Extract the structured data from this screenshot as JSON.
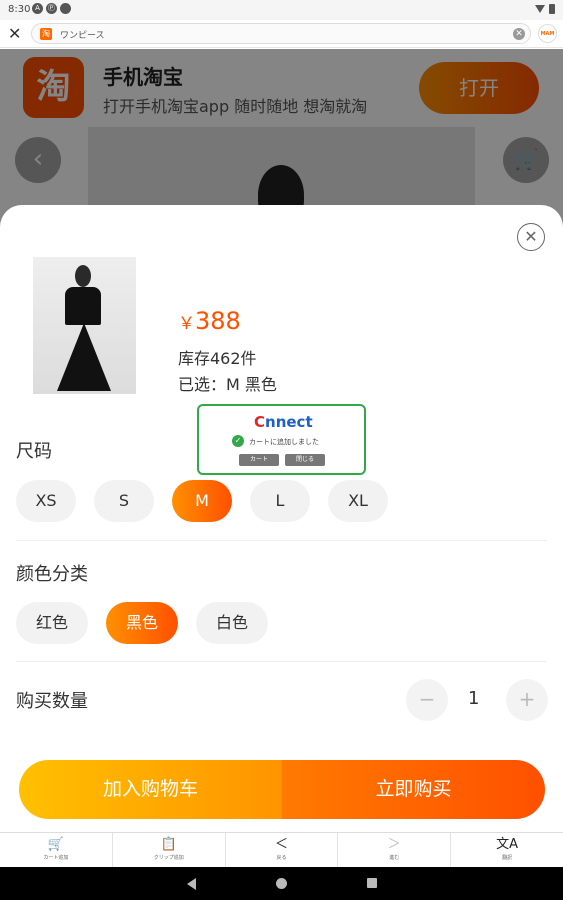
{
  "status_bar": {
    "time": "8:30",
    "icon_a": "A",
    "icon_b": "Ⓟ"
  },
  "browser": {
    "close_icon": "✕",
    "url_favicon": "淘",
    "url_text": "ワンピース",
    "clear_icon": "✕",
    "profile_label": "MAM"
  },
  "app_banner": {
    "logo_char": "淘",
    "name": "手机淘宝",
    "description": "打开手机淘宝app 随时随地 想淘就淘",
    "open_label": "打开"
  },
  "page_nav": {
    "back_icon": "‹",
    "cart_icon": "🛒"
  },
  "sheet": {
    "close_icon": "✕",
    "price_currency": "￥",
    "price_value": "388",
    "stock_text": "库存462件",
    "selected_text": "已选：M 黑色",
    "size_section": {
      "title": "尺码",
      "options": [
        "XS",
        "S",
        "M",
        "L",
        "XL"
      ],
      "selected": "M"
    },
    "color_section": {
      "title": "颜色分类",
      "options": [
        "红色",
        "黑色",
        "白色"
      ],
      "selected": "黑色"
    },
    "quantity_section": {
      "title": "购买数量",
      "minus_icon": "−",
      "value": "1",
      "plus_icon": "+"
    },
    "add_to_cart_label": "加入购物车",
    "buy_now_label": "立即购买"
  },
  "connect_popup": {
    "logo_c": "C",
    "logo_rest": "nnect",
    "message": "カートに追加しました",
    "cart_button": "カート",
    "close_button": "閉じる"
  },
  "bottom_toolbar": {
    "items": [
      {
        "icon": "🛒",
        "label": "カート追加"
      },
      {
        "icon": "📋",
        "label": "クリップ追加"
      },
      {
        "icon": "＜",
        "label": "戻る"
      },
      {
        "icon": "＞",
        "label": "進む"
      },
      {
        "icon": "文A",
        "label": "翻訳"
      }
    ]
  },
  "colors": {
    "accent_orange": "#ff5000",
    "accent_yellow": "#ffc000",
    "connect_green": "#33a84a"
  }
}
